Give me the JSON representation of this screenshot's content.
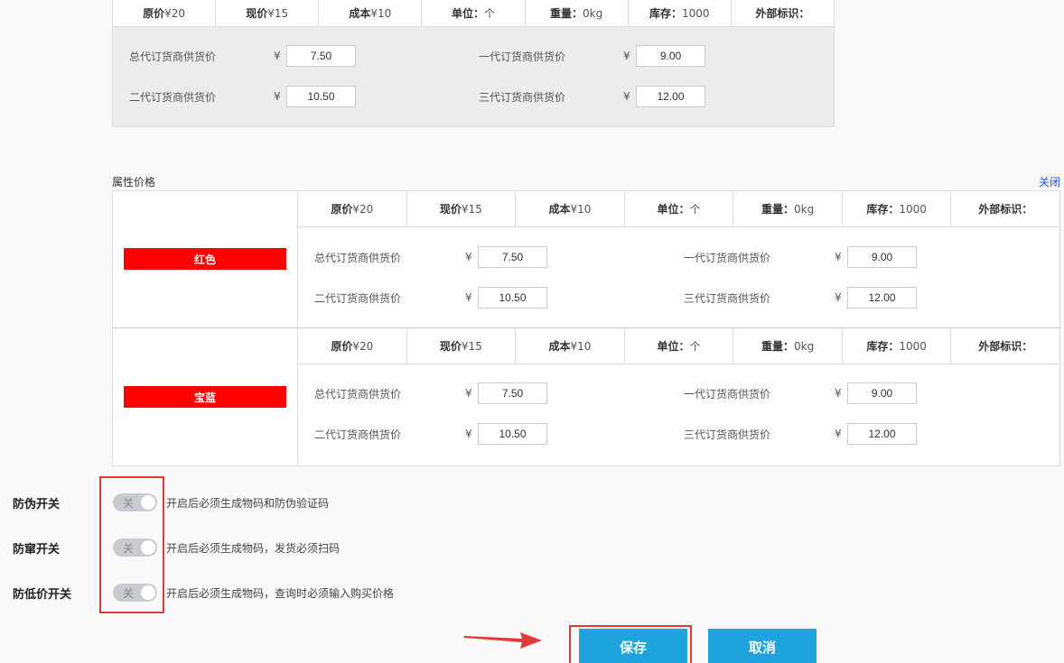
{
  "price_header": [
    {
      "key": "原价",
      "val": "¥20"
    },
    {
      "key": "现价",
      "val": "¥15"
    },
    {
      "key": "成本",
      "val": "¥10"
    },
    {
      "key": "单位：",
      "val": "个"
    },
    {
      "key": "重量：",
      "val": "0kg"
    },
    {
      "key": "库存：",
      "val": "1000"
    },
    {
      "key": "外部标识：",
      "val": ""
    }
  ],
  "top_prices": {
    "l1": "总代订货商供货价",
    "v1": "7.50",
    "l2": "一代订货商供货价",
    "v2": "9.00",
    "l3": "二代订货商供货价",
    "v3": "10.50",
    "l4": "三代订货商供货价",
    "v4": "12.00",
    "yen": "¥"
  },
  "attr": {
    "title": "属性价格",
    "close": "关闭",
    "groups": [
      {
        "color": "红色",
        "v1": "7.50",
        "v2": "9.00",
        "v3": "10.50",
        "v4": "12.00"
      },
      {
        "color": "宝蓝",
        "v1": "7.50",
        "v2": "9.00",
        "v3": "10.50",
        "v4": "12.00"
      }
    ]
  },
  "switches": [
    {
      "label": "防伪开关",
      "state": "关",
      "desc": "开启后必须生成物码和防伪验证码"
    },
    {
      "label": "防窜开关",
      "state": "关",
      "desc": "开启后必须生成物码，发货必须扫码"
    },
    {
      "label": "防低价开关",
      "state": "关",
      "desc": "开启后必须生成物码，查询时必须输入购买价格"
    }
  ],
  "buttons": {
    "save": "保存",
    "cancel": "取消"
  },
  "colors": {
    "accent": "#1ea3dc",
    "tag_red": "#ff0000",
    "highlight": "#e53935"
  }
}
